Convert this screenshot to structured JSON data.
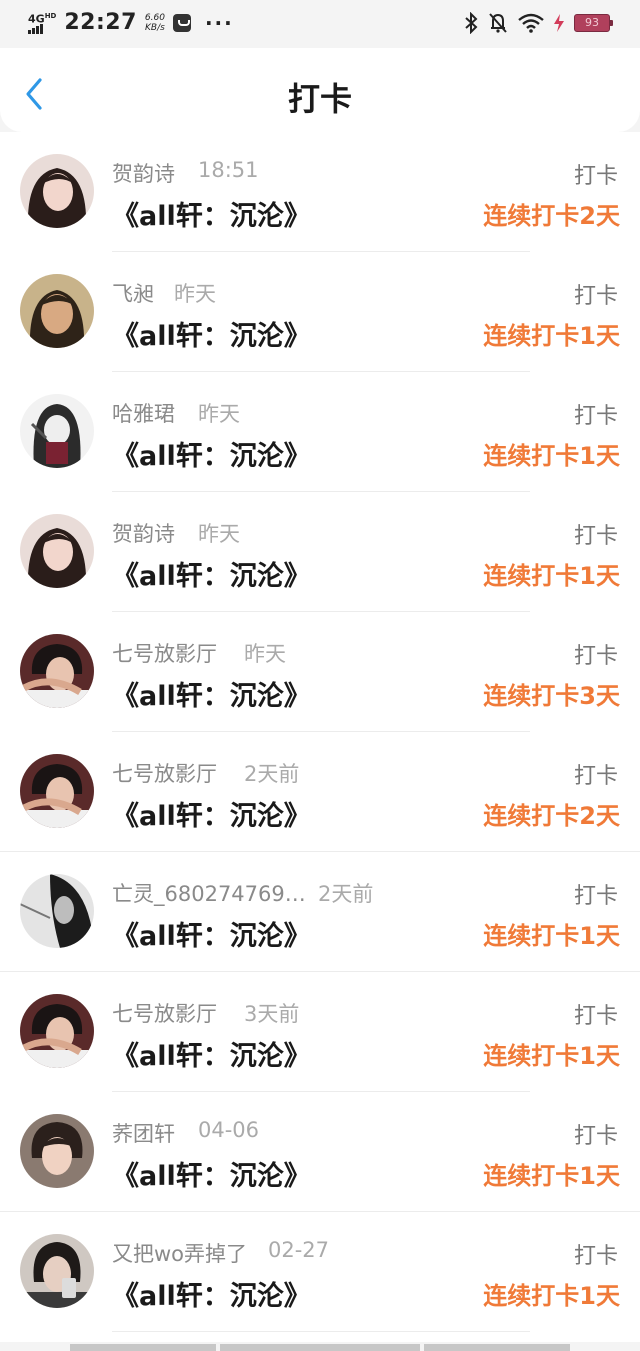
{
  "status_bar": {
    "network": "4G",
    "network_sup": "HD",
    "time": "22:27",
    "speed_value": "6.60",
    "speed_unit": "KB/s",
    "more": "···",
    "battery": "93"
  },
  "header": {
    "title": "打卡",
    "back_icon": "chevron-left-icon"
  },
  "colors": {
    "accent_orange": "#f07a38",
    "back_blue": "#2f98e6"
  },
  "checkins": [
    {
      "name": "贺韵诗",
      "time": "18:51",
      "book": "《all轩：沉沦》",
      "action": "打卡",
      "streak": "连续打卡2天",
      "avatar": "avatar-girl-1"
    },
    {
      "name": "飞昶",
      "time": "昨天",
      "book": "《all轩：沉沦》",
      "action": "打卡",
      "streak": "连续打卡1天",
      "avatar": "avatar-girl-2"
    },
    {
      "name": "哈雅珺",
      "time": "昨天",
      "book": "《all轩：沉沦》",
      "action": "打卡",
      "streak": "连续打卡1天",
      "avatar": "avatar-anime"
    },
    {
      "name": "贺韵诗",
      "time": "昨天",
      "book": "《all轩：沉沦》",
      "action": "打卡",
      "streak": "连续打卡1天",
      "avatar": "avatar-girl-1"
    },
    {
      "name": "七号放影厅",
      "time": "昨天",
      "book": "《all轩：沉沦》",
      "action": "打卡",
      "streak": "连续打卡3天",
      "avatar": "avatar-boy-1"
    },
    {
      "name": "七号放影厅",
      "time": "2天前",
      "book": "《all轩：沉沦》",
      "action": "打卡",
      "streak": "连续打卡2天",
      "avatar": "avatar-boy-1"
    },
    {
      "name": "亡灵_680274769…",
      "time": "2天前",
      "book": "《all轩：沉沦》",
      "action": "打卡",
      "streak": "连续打卡1天",
      "avatar": "avatar-dark"
    },
    {
      "name": "七号放影厅",
      "time": "3天前",
      "book": "《all轩：沉沦》",
      "action": "打卡",
      "streak": "连续打卡1天",
      "avatar": "avatar-boy-1"
    },
    {
      "name": "荞团轩",
      "time": "04-06",
      "book": "《all轩：沉沦》",
      "action": "打卡",
      "streak": "连续打卡1天",
      "avatar": "avatar-boy-2"
    },
    {
      "name": "又把wo弄掉了",
      "time": "02-27",
      "book": "《all轩：沉沦》",
      "action": "打卡",
      "streak": "连续打卡1天",
      "avatar": "avatar-boy-3"
    }
  ]
}
